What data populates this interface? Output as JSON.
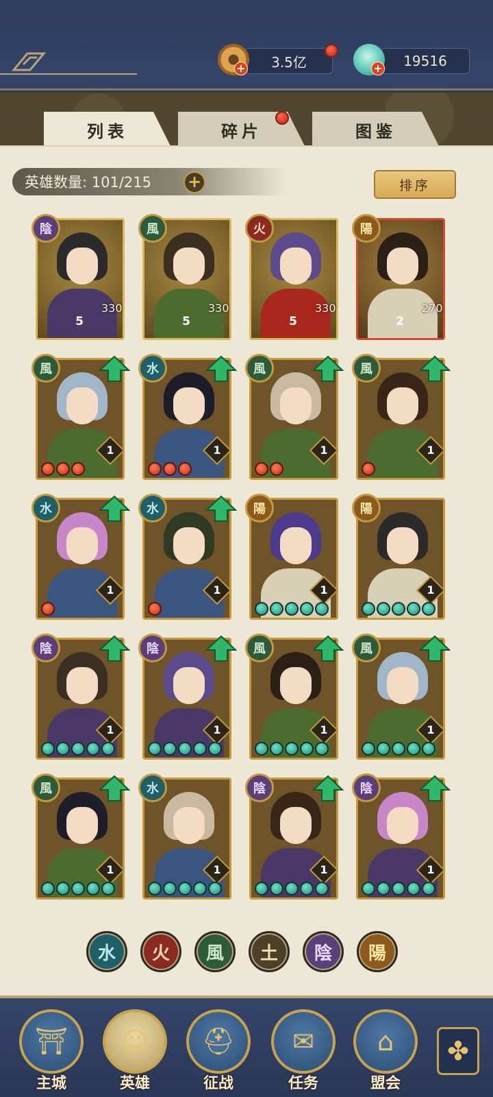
{
  "header": {
    "copper_amount": "3.5亿",
    "jade_amount": "19516",
    "copper_icon": "coin-icon",
    "jade_icon": "jade-shell-icon"
  },
  "tabs": [
    {
      "label": "列表",
      "active": true
    },
    {
      "label": "碎片",
      "active": false,
      "has_alert": true
    },
    {
      "label": "图鉴",
      "active": false
    }
  ],
  "hero_count": {
    "label": "英雄数量: 101/215"
  },
  "sort_button": {
    "label": "排序"
  },
  "elements": {
    "water": "水",
    "fire": "火",
    "wind": "風",
    "earth": "土",
    "yin": "陰",
    "yang": "陽"
  },
  "heroes": [
    {
      "element": "陰",
      "el": "yin",
      "stars": "5",
      "power": "330",
      "frame": "gold"
    },
    {
      "element": "風",
      "el": "wind",
      "stars": "5",
      "power": "330",
      "frame": "gold"
    },
    {
      "element": "火",
      "el": "fire",
      "stars": "5",
      "power": "330",
      "frame": "gold"
    },
    {
      "element": "陽",
      "el": "yang",
      "stars": "2",
      "power": "270",
      "frame": "red"
    },
    {
      "element": "風",
      "el": "wind",
      "level": "1",
      "upgrade": true,
      "dots": [
        "red",
        "red",
        "red"
      ]
    },
    {
      "element": "水",
      "el": "water",
      "level": "1",
      "upgrade": true,
      "dots": [
        "red",
        "red",
        "red"
      ]
    },
    {
      "element": "風",
      "el": "wind",
      "level": "1",
      "upgrade": true,
      "dots": [
        "red",
        "red"
      ]
    },
    {
      "element": "風",
      "el": "wind",
      "level": "1",
      "upgrade": true,
      "dots": [
        "red"
      ]
    },
    {
      "element": "水",
      "el": "water",
      "level": "1",
      "upgrade": true,
      "dots": [
        "red"
      ]
    },
    {
      "element": "水",
      "el": "water",
      "level": "1",
      "upgrade": true,
      "dots": [
        "red"
      ]
    },
    {
      "element": "陽",
      "el": "yang",
      "level": "1",
      "upgrade": false,
      "dots": [
        "green",
        "green",
        "green",
        "green",
        "green"
      ]
    },
    {
      "element": "陽",
      "el": "yang",
      "level": "1",
      "upgrade": false,
      "dots": [
        "green",
        "green",
        "green",
        "green",
        "green"
      ]
    },
    {
      "element": "陰",
      "el": "yin",
      "level": "1",
      "upgrade": true,
      "dots": [
        "green",
        "green",
        "green",
        "green",
        "green"
      ]
    },
    {
      "element": "陰",
      "el": "yin",
      "level": "1",
      "upgrade": true,
      "dots": [
        "green",
        "green",
        "green",
        "green",
        "green"
      ]
    },
    {
      "element": "風",
      "el": "wind",
      "level": "1",
      "upgrade": true,
      "dots": [
        "green",
        "green",
        "green",
        "green",
        "green"
      ]
    },
    {
      "element": "風",
      "el": "wind",
      "level": "1",
      "upgrade": true,
      "dots": [
        "green",
        "green",
        "green",
        "green",
        "green"
      ]
    },
    {
      "element": "風",
      "el": "wind",
      "level": "1",
      "upgrade": true,
      "dots": [
        "green",
        "green",
        "green",
        "green",
        "green"
      ]
    },
    {
      "element": "水",
      "el": "water",
      "level": "1",
      "upgrade": false,
      "dots": [
        "green",
        "green",
        "green",
        "green",
        "green"
      ]
    },
    {
      "element": "陰",
      "el": "yin",
      "level": "1",
      "upgrade": true,
      "dots": [
        "green",
        "green",
        "green",
        "green",
        "green"
      ]
    },
    {
      "element": "陰",
      "el": "yin",
      "level": "1",
      "upgrade": true,
      "dots": [
        "green",
        "green",
        "green",
        "green",
        "green"
      ]
    }
  ],
  "filters": [
    "水",
    "火",
    "風",
    "土",
    "陰",
    "陽"
  ],
  "nav": [
    {
      "label": "主城",
      "icon": "palace-icon"
    },
    {
      "label": "英雄",
      "icon": "hero-portrait-icon"
    },
    {
      "label": "征战",
      "icon": "battle-helmet-icon"
    },
    {
      "label": "任务",
      "icon": "scroll-icon"
    },
    {
      "label": "盟会",
      "icon": "pavilion-icon"
    }
  ],
  "colors": {
    "gold_frame": "#c49a3c",
    "parchment": "#ede8d6",
    "navy": "#2e3d5c"
  }
}
